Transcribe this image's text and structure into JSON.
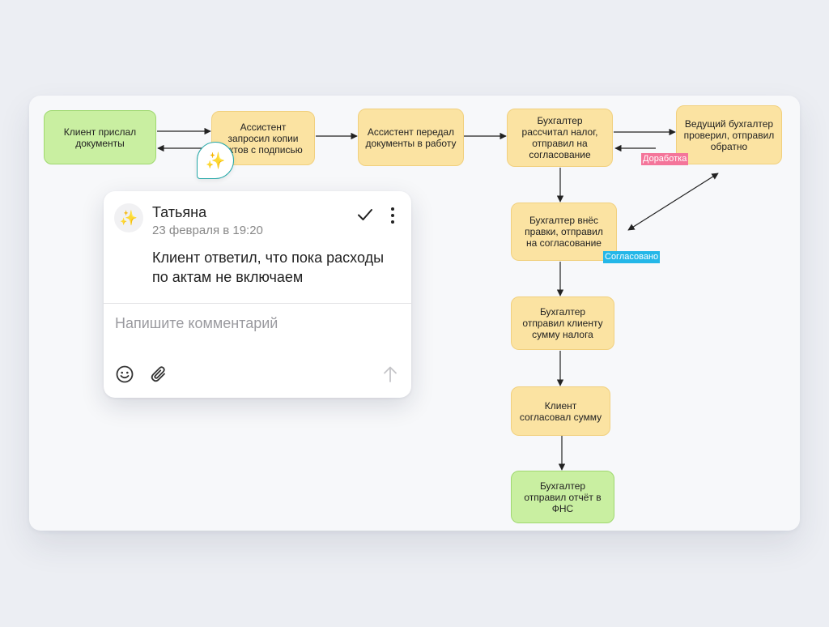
{
  "flow": {
    "nodes": [
      {
        "id": "n1",
        "label": "Клиент прислал документы"
      },
      {
        "id": "n2",
        "label": "Ассистент запросил копии актов с подписью"
      },
      {
        "id": "n3",
        "label": "Ассистент передал документы в работу"
      },
      {
        "id": "n4",
        "label": "Бухгалтер рассчитал налог, отправил на согласование"
      },
      {
        "id": "n5",
        "label": "Ведущий бухгалтер проверил, отправил обратно"
      },
      {
        "id": "n6",
        "label": "Бухгалтер внёс правки, отправил на согласование"
      },
      {
        "id": "n7",
        "label": "Бухгалтер отправил клиенту сумму налога"
      },
      {
        "id": "n8",
        "label": "Клиент согласовал сумму"
      },
      {
        "id": "n9",
        "label": "Бухгалтер отправил отчёт в ФНС"
      }
    ],
    "tags": {
      "rework": "Доработка",
      "approved": "Согласовано"
    },
    "colors": {
      "yellow": "#fbe3a2",
      "green": "#c9efa1",
      "rework_tag": "#f4759a",
      "approved_tag": "#24b7e8",
      "pin_border": "#25a8a8"
    }
  },
  "comment_pin": {
    "icon": "sparkles-icon",
    "glyph": "✨"
  },
  "comment_card": {
    "avatar_glyph": "✨",
    "author": "Татьяна",
    "date": "23 февраля в 19:20",
    "text": "Клиент ответил, что пока расходы по актам не включаем",
    "input_placeholder": "Напишите комментарий",
    "icons": [
      "check-icon",
      "more-icon",
      "emoji-icon",
      "attach-icon",
      "send-icon"
    ]
  }
}
